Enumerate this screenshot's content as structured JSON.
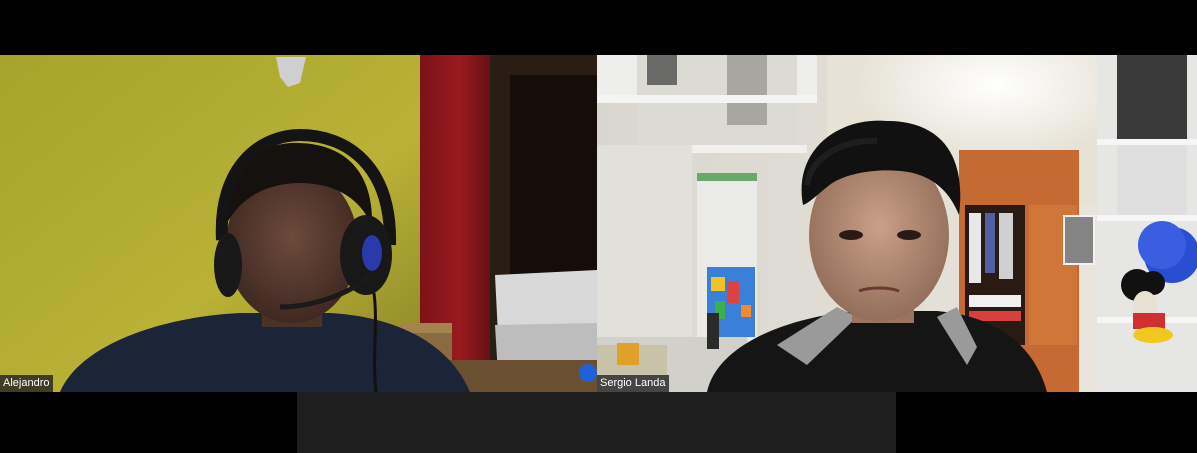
{
  "participants": [
    {
      "name": "Alejandro"
    },
    {
      "name": "Sergio Landa"
    }
  ],
  "colors": {
    "background": "#000000",
    "name_tag_bg": "#1e1e1e",
    "bottom_bar": "#1e1e1e"
  }
}
